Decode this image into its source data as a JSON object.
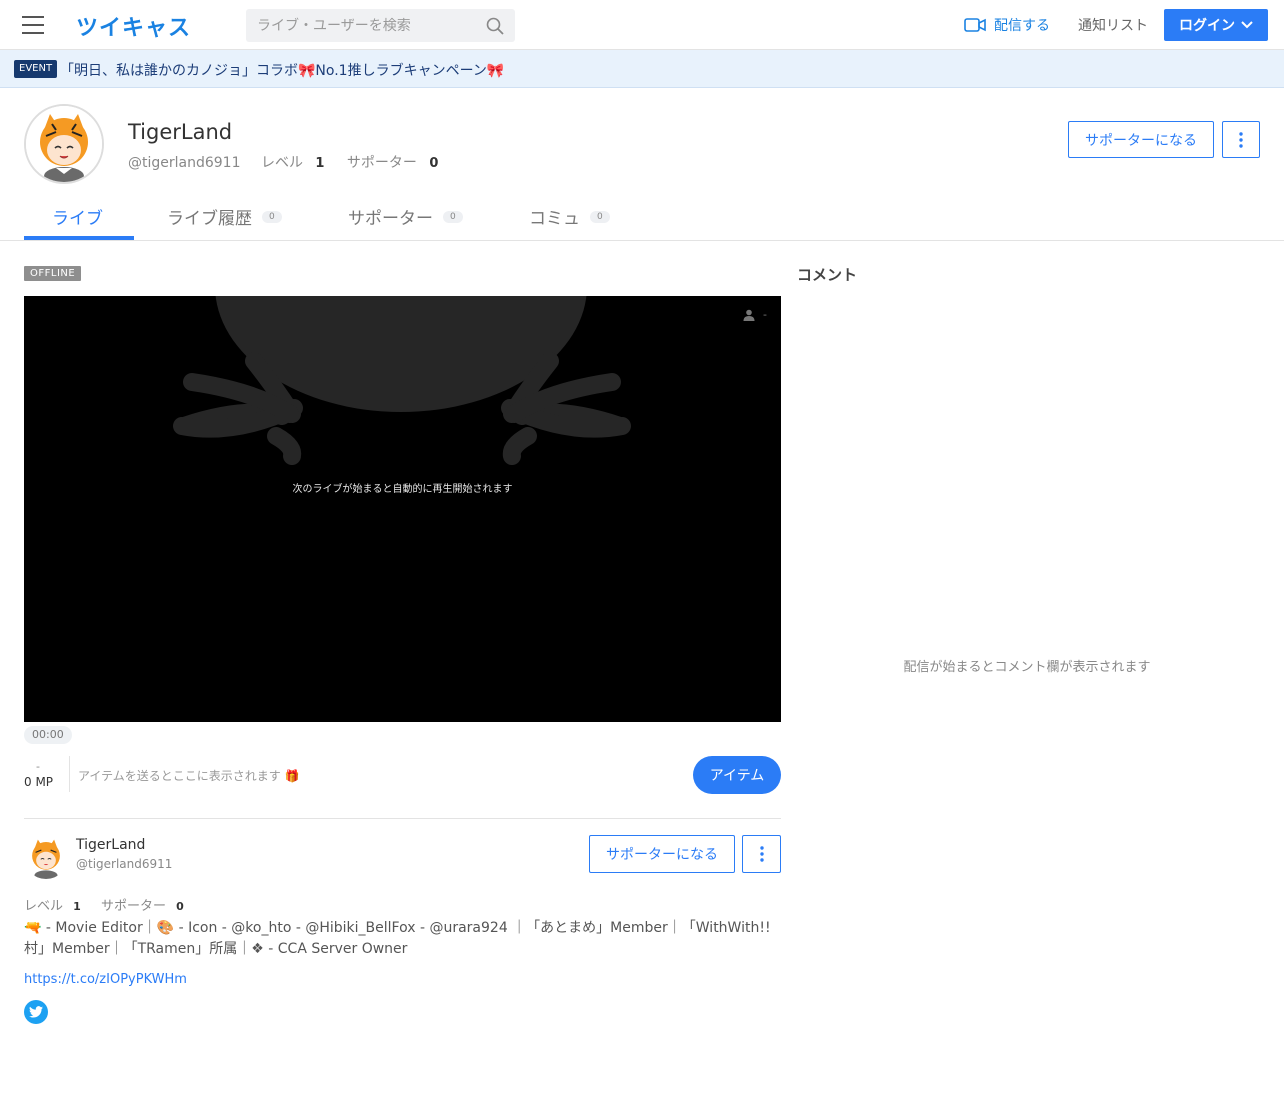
{
  "header": {
    "logo": "ツイキャス",
    "search_placeholder": "ライブ・ユーザーを検索",
    "stream_label": "配信する",
    "notify_label": "通知リスト",
    "login_label": "ログイン"
  },
  "event": {
    "badge": "EVENT",
    "text": "「明日、私は誰かのカノジョ」コラボ🎀No.1推しラブキャンペーン🎀"
  },
  "profile": {
    "name": "TigerLand",
    "handle": "@tigerland6911",
    "level_label": "レベル",
    "level": "1",
    "supporter_label": "サポーター",
    "supporters": "0",
    "become_supporter": "サポーターになる"
  },
  "tabs": [
    {
      "label": "ライブ",
      "count": ""
    },
    {
      "label": "ライブ履歴",
      "count": "0"
    },
    {
      "label": "サポーター",
      "count": "0"
    },
    {
      "label": "コミュ",
      "count": "0"
    }
  ],
  "player": {
    "status": "OFFLINE",
    "message": "次のライブが始まると自動的に再生開始されます",
    "viewers": "-",
    "timecode": "00:00"
  },
  "items": {
    "mp_dash": "-",
    "mp_value": "0 MP",
    "hint": "アイテムを送るとここに表示されます 🎁",
    "button": "アイテム"
  },
  "lower_profile": {
    "name": "TigerLand",
    "handle": "@tigerland6911",
    "become_supporter": "サポーターになる",
    "level_label": "レベル",
    "level": "1",
    "supporter_label": "サポーター",
    "supporters": "0",
    "bio": "🔫 - Movie Editor｜🎨 - Icon - @ko_hto - @Hibiki_BellFox - @urara924 ｜「あとまめ」Member｜「WithWith!!村」Member｜「TRamen」所属｜❖ - CCA Server Owner",
    "link": "https://t.co/zIOPyPKWHm"
  },
  "comments": {
    "title": "コメント",
    "placeholder": "配信が始まるとコメント欄が表示されます"
  },
  "colors": {
    "accent": "#2b7cf6",
    "logo": "#1a82e2",
    "event_bg": "#e8f2fc",
    "event_badge": "#16396e",
    "twitter": "#1da1f2"
  },
  "icons": [
    "hamburger-icon",
    "search-icon",
    "video-camera-icon",
    "chevron-down-icon",
    "kebab-icon",
    "person-icon",
    "twitter-icon"
  ]
}
